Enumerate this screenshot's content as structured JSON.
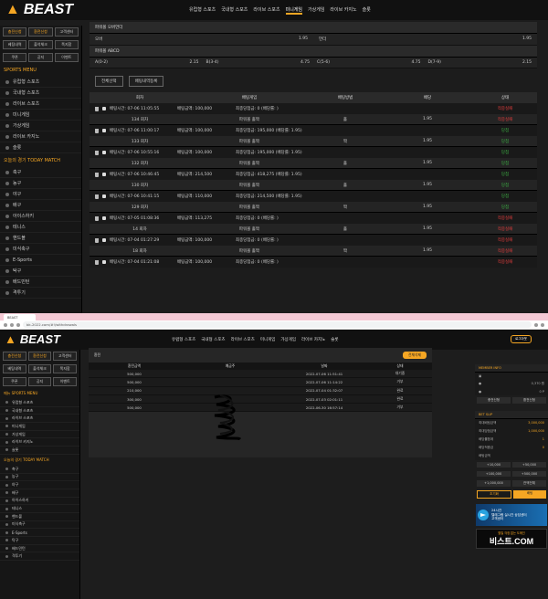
{
  "brand": {
    "name": "BEAST"
  },
  "top": {
    "nav": [
      "유럽형 스포츠",
      "국내형 스포츠",
      "라이브 스포츠",
      "미니게임",
      "가상게임",
      "라이브 카지노",
      "슬롯"
    ],
    "sidebar": {
      "buttons_row1": [
        "충전신청",
        "환전신청",
        "고객센터"
      ],
      "buttons_row2": [
        "베팅내역",
        "출석체크",
        "쪽지함"
      ],
      "buttons_row3": [
        "쿠폰",
        "공지",
        "이벤트"
      ],
      "menu_title": "SPORTS MENU",
      "menu_items": [
        "유럽형 스포츠",
        "국내형 스포츠",
        "라이브 스포츠",
        "미니게임",
        "가상게임",
        "라이브 카지노",
        "슬롯"
      ],
      "today_title": "오늘의 경기 TODAY MATCH",
      "today_items": [
        "축구",
        "농구",
        "야구",
        "배구",
        "아이스하키",
        "테니스",
        "핸드볼",
        "미식축구",
        "E-Sports",
        "탁구",
        "배드민턴",
        "격투기"
      ]
    },
    "odds": {
      "section1": "파워볼 오버언더",
      "row1": [
        "오버",
        "",
        "1.95",
        "언더",
        "",
        "1.95"
      ],
      "section2": "파워볼 ABCD",
      "row2": [
        "A(0-2)",
        "2.15",
        "B(3-4)",
        "4.75",
        "C(5-6)",
        "4.75",
        "D(7-9)",
        "2.15"
      ]
    },
    "tools": [
      "전체선택",
      "배팅내역등록"
    ],
    "bet_table": {
      "headers": [
        "회차",
        "배팅게임",
        "배팅방법",
        "배당",
        "상태"
      ],
      "items": [
        {
          "info": [
            "배팅시간: 07-06 11:05:55",
            "배팅금액: 100,000",
            "최종당첨금: 0 (배당률: )"
          ],
          "round": "134 회차",
          "game": "파워볼 홀짝",
          "pick": "홀",
          "odds": "1.95",
          "status": "적중실패",
          "status_head": "적중실패",
          "color": "red"
        },
        {
          "info": [
            "배팅시간: 07-06 11:00:17",
            "배팅금액: 100,000",
            "최종당첨금: 195,000 (배당률: 1.95)"
          ],
          "round": "133 회차",
          "game": "파워볼 홀짝",
          "pick": "짝",
          "odds": "1.95",
          "status": "당첨",
          "status_head": "당첨",
          "color": "green"
        },
        {
          "info": [
            "배팅시간: 07-06 10:55:16",
            "배팅금액: 100,000",
            "최종당첨금: 195,000 (배당률: 1.95)"
          ],
          "round": "132 회차",
          "game": "파워볼 홀짝",
          "pick": "홀",
          "odds": "1.95",
          "status": "당첨",
          "status_head": "당첨",
          "color": "green"
        },
        {
          "info": [
            "배팅시간: 07-06 10:46:45",
            "배팅금액: 214,500",
            "최종당첨금: 418,275 (배당률: 1.95)"
          ],
          "round": "130 회차",
          "game": "파워볼 홀짝",
          "pick": "홀",
          "odds": "1.95",
          "status": "당첨",
          "status_head": "당첨",
          "color": "green"
        },
        {
          "info": [
            "배팅시간: 07-06 10:41:15",
            "배팅금액: 110,000",
            "최종당첨금: 214,500 (배당률: 1.95)"
          ],
          "round": "129 회차",
          "game": "파워볼 홀짝",
          "pick": "짝",
          "odds": "1.95",
          "status": "당첨",
          "status_head": "당첨",
          "color": "green"
        },
        {
          "info": [
            "배팅시간: 07-05 01:08:36",
            "배팅금액: 113,275",
            "최종당첨금: 0 (배당률: )"
          ],
          "round": "14 회차",
          "game": "파워볼 홀짝",
          "pick": "홀",
          "odds": "1.95",
          "status": "적중실패",
          "status_head": "적중실패",
          "color": "red"
        },
        {
          "info": [
            "배팅시간: 07-04 01:27:29",
            "배팅금액: 100,000",
            "최종당첨금: 0 (배당률: )"
          ],
          "round": "18 회차",
          "game": "파워볼 홀짝",
          "pick": "짝",
          "odds": "1.95",
          "status": "적중실패",
          "status_head": "적중실패",
          "color": "red"
        },
        {
          "info": [
            "배팅시간: 07-04 01:21:08",
            "배팅금액: 100,000",
            "최종당첨금: 0 (배당률: )"
          ],
          "round": "",
          "game": "",
          "pick": "",
          "odds": "",
          "status": "",
          "status_head": "적중실패",
          "color": "red"
        }
      ]
    }
  },
  "browser": {
    "tab_title": "BEAST",
    "url": "bk-2022.com/#!/withdrawals"
  },
  "bottom": {
    "nav": [
      "유럽형 스포츠",
      "국내형 스포츠",
      "라이브 스포츠",
      "미니게임",
      "가상게임",
      "라이브 카지노",
      "슬롯"
    ],
    "login": "로그아웃",
    "sidebar": {
      "buttons_row1": [
        "충전신청",
        "환전신청",
        "고객센터"
      ],
      "buttons_row2": [
        "베팅내역",
        "출석체크",
        "쪽지함"
      ],
      "buttons_row3": [
        "쿠폰",
        "공지",
        "이벤트"
      ],
      "menu_title": "메뉴 SPORTS MENU",
      "menu_items": [
        "유럽형 스포츠",
        "국내형 스포츠",
        "라이브 스포츠",
        "미니게임",
        "가상게임",
        "라이브 카지노",
        "슬롯"
      ],
      "today_title": "오늘의 경기 TODAY MATCH",
      "today_items": [
        "축구",
        "농구",
        "야구",
        "배구",
        "아이스하키",
        "테니스",
        "핸드볼",
        "미식축구",
        "E-Sports",
        "탁구",
        "배드민턴",
        "격투기"
      ]
    },
    "withdraw": {
      "title": "환전",
      "button": "전체삭제",
      "headers": [
        "환전금액",
        "예금주",
        "날짜",
        "상태"
      ],
      "rows": [
        [
          "500,000",
          "",
          "2022-07-06 11:51:41",
          "대기중"
        ],
        [
          "500,000",
          "",
          "2022-07-06 11:14:22",
          "거부"
        ],
        [
          "210,000",
          "",
          "2022-07-04 01:32:07",
          "완료"
        ],
        [
          "300,000",
          "",
          "2022-07-03 02:01:11",
          "완료"
        ],
        [
          "500,000",
          "",
          "2022-06-30 16:57:14",
          "거부"
        ]
      ]
    },
    "right": {
      "member_info": "MEMBER INFO",
      "member_lines": [
        [
          "",
          ""
        ],
        [
          "",
          "0,370 원"
        ],
        [
          "",
          "0 P"
        ]
      ],
      "member_buttons": [
        "충전신청",
        "환전신청"
      ],
      "bet_slip": "BET SLIP",
      "slip_lines": [
        [
          "최대배팅금액",
          "3,000,000"
        ],
        [
          "최대당첨금액",
          "1,000,000"
        ],
        [
          "배당률합계",
          "1"
        ],
        [
          "배당적중금",
          "0"
        ]
      ],
      "bet_amount": "배팅금액",
      "amount_buttons": [
        [
          "+10,000",
          "+50,000"
        ],
        [
          "+100,000",
          "+500,000"
        ],
        [
          "+1,000,000",
          "잔액전체"
        ]
      ],
      "final_buttons": [
        "초기화",
        "배팅"
      ],
      "banner1": [
        "24시간",
        "텔레그램 실시간 상담센터",
        "고객센터"
      ],
      "banner2": [
        "짤릴 걱정 없는 도메인",
        "비스트.COM"
      ]
    }
  }
}
